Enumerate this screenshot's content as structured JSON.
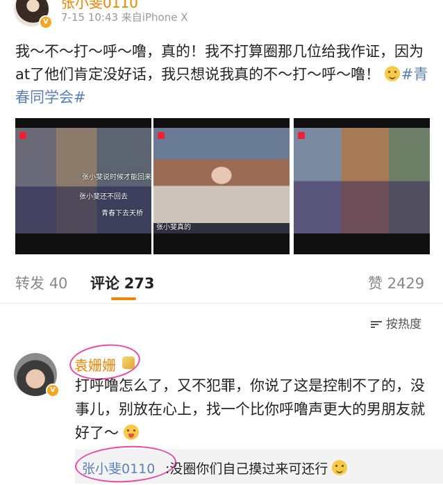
{
  "post": {
    "author_name": "张小斐0110",
    "meta": "7-15 10:43  来自iPhone X",
    "text_part1": "我～不～打～呼～噜，真的！我不打算圈那几位给我作证，因为at了他们肯定没好话，我只想说我真的不～打～呼～噜！",
    "hashtag": "#青春同学会#",
    "images": [
      {
        "caption_a": "张小斐说时候才能回来",
        "caption_b": "张小斐还不回去",
        "caption_c": "青春下去天桥"
      },
      {
        "caption_a": "张小斐真的"
      },
      {
        "caption_a": ""
      }
    ]
  },
  "stats": {
    "repost_label": "转发",
    "repost_count": "40",
    "comment_label": "评论",
    "comment_count": "273",
    "like_label": "赞",
    "like_count": "2429"
  },
  "sort": {
    "label": "按热度"
  },
  "comment": {
    "author_name": "袁姗姗",
    "text": "打呼噜怎么了，又不犯罪，你说了这是控制不了的，没事儿，别放在心上，找一个比你呼噜声更大的男朋友就好了～",
    "reply_author": "张小斐0110",
    "reply_text": ":没圈你们自己摸过来可还行"
  },
  "colors": {
    "accent": "#f08300",
    "link": "#5b7fb8",
    "circle": "#e64aa8"
  }
}
